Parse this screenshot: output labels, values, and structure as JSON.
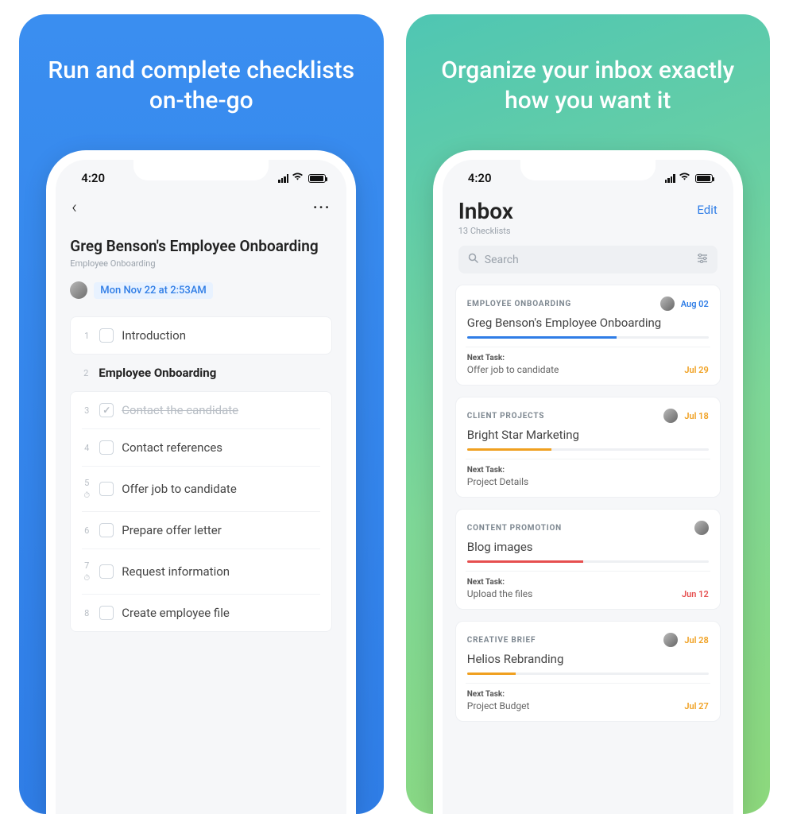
{
  "left": {
    "headline": "Run and complete checklists on-the-go",
    "status_time": "4:20",
    "title": "Greg Benson's Employee Onboarding",
    "subtitle": "Employee Onboarding",
    "date": "Mon Nov 22 at 2:53AM",
    "tasks": [
      {
        "num": "1",
        "label": "Introduction",
        "type": "check"
      },
      {
        "num": "2",
        "label": "Employee Onboarding",
        "type": "heading"
      },
      {
        "num": "3",
        "label": "Contact the candidate",
        "type": "done"
      },
      {
        "num": "4",
        "label": "Contact references",
        "type": "check"
      },
      {
        "num": "5",
        "label": "Offer job to candidate",
        "type": "check",
        "timer": true
      },
      {
        "num": "6",
        "label": "Prepare offer letter",
        "type": "check"
      },
      {
        "num": "7",
        "label": "Request information",
        "type": "check",
        "timer": true
      },
      {
        "num": "8",
        "label": "Create employee file",
        "type": "check"
      }
    ]
  },
  "right": {
    "headline": "Organize your inbox exactly how you want it",
    "status_time": "4:20",
    "inbox_title": "Inbox",
    "inbox_sub": "13 Checklists",
    "edit": "Edit",
    "search_placeholder": "Search",
    "cards": [
      {
        "cat": "EMPLOYEE ONBOARDING",
        "title": "Greg Benson's Employee Onboarding",
        "date": "Aug 02",
        "date_class": "d-blue",
        "prog": 62,
        "prog_class": "pf-blue",
        "next_task": "Offer job to candidate",
        "next_date": "Jul 29",
        "next_class": "d-orange"
      },
      {
        "cat": "CLIENT PROJECTS",
        "title": "Bright Star Marketing",
        "date": "Jul 18",
        "date_class": "d-orange",
        "prog": 35,
        "prog_class": "pf-orange",
        "next_task": "Project Details",
        "next_date": "",
        "next_class": ""
      },
      {
        "cat": "CONTENT PROMOTION",
        "title": "Blog images",
        "date": "",
        "date_class": "",
        "prog": 48,
        "prog_class": "pf-red",
        "next_task": "Upload the files",
        "next_date": "Jun 12",
        "next_class": "d-red"
      },
      {
        "cat": "CREATIVE BRIEF",
        "title": "Helios Rebranding",
        "date": "Jul 28",
        "date_class": "d-orange",
        "prog": 20,
        "prog_class": "pf-orange",
        "next_task": "Project Budget",
        "next_date": "Jul 27",
        "next_class": "d-orange"
      }
    ],
    "next_label": "Next Task:"
  }
}
